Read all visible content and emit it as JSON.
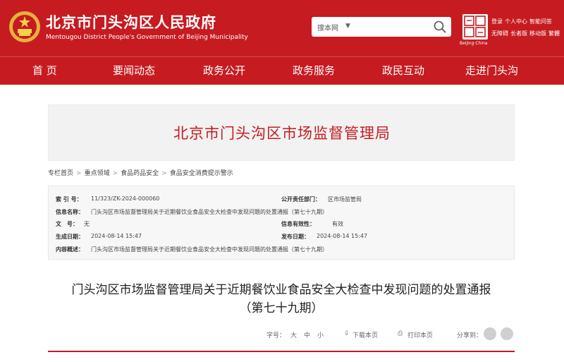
{
  "header": {
    "title": "北京市门头沟区人民政府",
    "subtitle": "Mentougou District People's Government of Beijing Municipality",
    "search_scope": "搜本网",
    "search_placeholder": "",
    "logo_caption": "Beijing·China",
    "tools_line1": [
      "登录",
      "个人中心",
      "智能问答"
    ],
    "tools_line2": [
      "无障碍",
      "长者版",
      "移动版",
      "繁體"
    ]
  },
  "nav": {
    "items": [
      "首 页",
      "要闻动态",
      "政务公开",
      "政务服务",
      "政民互动",
      "走进门头沟"
    ]
  },
  "banner": {
    "title": "北京市门头沟区市场监督管理局"
  },
  "breadcrumb": [
    "专栏首页",
    "重点领域",
    "食品药品安全",
    "食品安全消费提示警示"
  ],
  "info": {
    "index_label": "索 引 号：",
    "index_value": "11/323/ZK-2024-000060",
    "resp_label": "公开责任部门：",
    "resp_value": "区市场监管局",
    "info_name_label": "信息名称：",
    "info_name_value": "门头沟区市场监督管理局关于近期餐饮业食品安全大检查中发现问题的处置通报（第七十九期）",
    "doc_no_label": "文　号：",
    "doc_no_value": "无",
    "validity_label": "信息有效性：",
    "validity_value": "有效",
    "created_label": "生成日期：",
    "created_value": "2024-08-14 15:47",
    "published_label": "发布日期：",
    "published_value": "2024-08-14 15:47",
    "summary_label": "内容概述：",
    "summary_value": "门头沟区市场监督管理局关于近期餐饮业食品安全大检查中发现问题的处置通报（第七十九期）"
  },
  "article": {
    "title_line1": "门头沟区市场监督管理局关于近期餐饮业食品安全大检查中发现问题的处置通报",
    "title_line2": "（第七十九期）"
  },
  "toolbar": {
    "font_label": "字号：",
    "font_large": "大",
    "font_medium": "中",
    "font_small": "小",
    "download": "下载本页",
    "print": "打印本页",
    "share": "分享到："
  },
  "colors": {
    "brand_red": "#c61b20"
  }
}
